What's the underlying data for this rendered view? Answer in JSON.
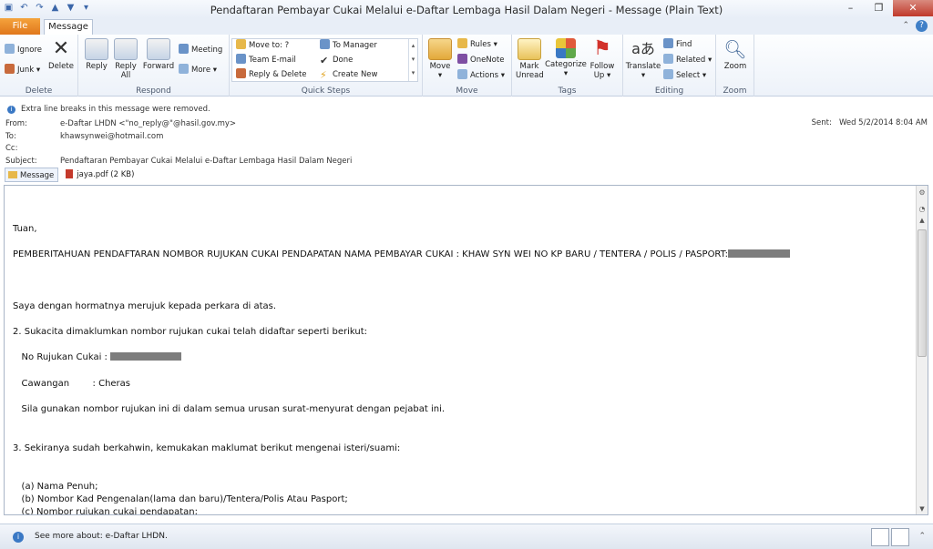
{
  "window": {
    "title": "Pendaftaran Pembayar Cukai Melalui e-Daftar Lembaga Hasil Dalam Negeri  -  Message (Plain Text)"
  },
  "tabs": {
    "file": "File",
    "message": "Message"
  },
  "ribbon": {
    "delete_group": {
      "label": "Delete",
      "ignore": "Ignore",
      "junk": "Junk",
      "delete": "Delete"
    },
    "respond_group": {
      "label": "Respond",
      "reply": "Reply",
      "reply_all_1": "Reply",
      "reply_all_2": "All",
      "forward": "Forward",
      "meeting": "Meeting",
      "more": "More"
    },
    "quick_steps": {
      "label": "Quick Steps",
      "move_to": "Move to: ?",
      "team_email": "Team E-mail",
      "reply_delete": "Reply & Delete",
      "to_manager": "To Manager",
      "done": "Done",
      "create_new": "Create New"
    },
    "move_group": {
      "label": "Move",
      "move": "Move",
      "rules": "Rules",
      "onenote": "OneNote",
      "actions": "Actions"
    },
    "tags_group": {
      "label": "Tags",
      "mark_unread_1": "Mark",
      "mark_unread_2": "Unread",
      "categorize": "Categorize",
      "follow_up_1": "Follow",
      "follow_up_2": "Up"
    },
    "editing_group": {
      "label": "Editing",
      "translate": "Translate",
      "find": "Find",
      "related": "Related",
      "select": "Select"
    },
    "zoom_group": {
      "label": "Zoom",
      "zoom": "Zoom"
    }
  },
  "header": {
    "info": "Extra line breaks in this message were removed.",
    "from_label": "From:",
    "from": "e-Daftar LHDN <\"no_reply@\"@hasil.gov.my>",
    "to_label": "To:",
    "to": "khawsynwei@hotmail.com",
    "cc_label": "Cc:",
    "subject_label": "Subject:",
    "subject": "Pendaftaran Pembayar Cukai Melalui e-Daftar Lembaga Hasil Dalam Negeri",
    "sent_label": "Sent:",
    "sent": "Wed 5/2/2014 8:04 AM"
  },
  "attachments": {
    "message": "Message",
    "file": "jaya.pdf (2 KB)"
  },
  "body": {
    "greeting": "Tuan,",
    "heading": "PEMBERITAHUAN PENDAFTARAN NOMBOR RUJUKAN CUKAI PENDAPATAN NAMA PEMBAYAR CUKAI : KHAW SYN WEI NO KP BARU / TENTERA / POLIS / PASPORT:",
    "p1": "Saya dengan hormatnya merujuk kepada perkara di atas.",
    "p2": "2. Sukacita dimaklumkan nombor rujukan cukai telah didaftar seperti berikut:",
    "ref_label": "   No Rujukan Cukai : ",
    "branch": "   Cawangan        : Cheras",
    "p3": "   Sila gunakan nombor rujukan ini di dalam semua urusan surat-menyurat dengan pejabat ini.",
    "p4": "3. Sekiranya sudah berkahwin, kemukakan maklumat berikut mengenai isteri/suami:",
    "a": "   (a) Nama Penuh;",
    "b": "   (b) Nombor Kad Pengenalan(lama dan baru)/Tentera/Polis Atau Pasport;",
    "c": "   (c) Nombor rujukan cukai pendapatan;"
  },
  "status": {
    "text": "See more about: e-Daftar LHDN."
  },
  "colors": {
    "file_tab": "#e0771c",
    "accent": "#3a78c4",
    "redaction": "#7d7d7d"
  }
}
